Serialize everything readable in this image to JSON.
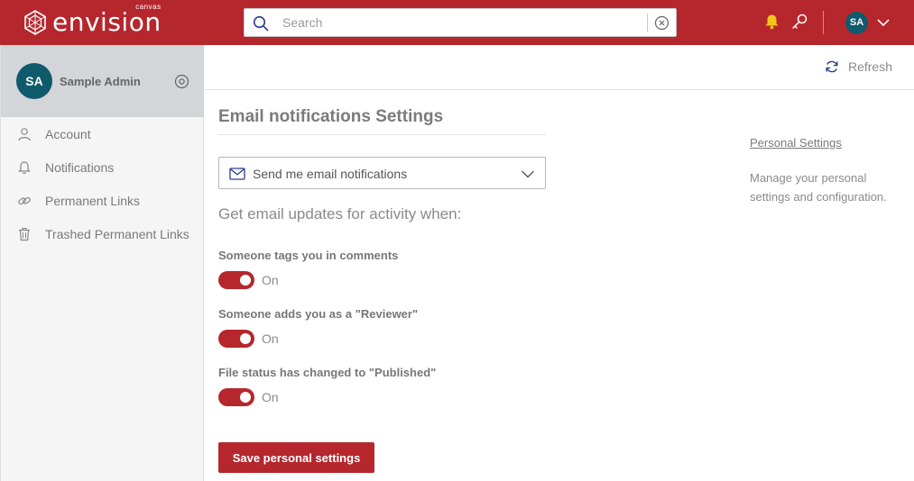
{
  "header": {
    "brand": {
      "name": "envision",
      "sub": "canvas"
    },
    "search": {
      "placeholder": "Search",
      "value": ""
    },
    "user_initials": "SA",
    "icons": [
      "search-icon",
      "clear-icon",
      "bell-icon",
      "key-icon",
      "chevron-down-icon"
    ]
  },
  "sidebar": {
    "profile": {
      "initials": "SA",
      "name": "Sample Admin"
    },
    "items": [
      {
        "label": "Account",
        "icon": "user-icon"
      },
      {
        "label": "Notifications",
        "icon": "bell-icon"
      },
      {
        "label": "Permanent Links",
        "icon": "link-icon"
      },
      {
        "label": "Trashed Permanent Links",
        "icon": "trash-icon"
      }
    ]
  },
  "toolbar": {
    "refresh_label": "Refresh"
  },
  "main": {
    "title": "Email notifications Settings",
    "frequency": {
      "selected": "Send me email notifications"
    },
    "subtitle": "Get email updates for activity when:",
    "options": [
      {
        "label": "Someone tags you in comments",
        "state": "On"
      },
      {
        "label": "Someone adds you as a \"Reviewer\"",
        "state": "On"
      },
      {
        "label": "File status has changed to \"Published\"",
        "state": "On"
      }
    ],
    "save_label": "Save personal settings"
  },
  "right_panel": {
    "link": "Personal Settings",
    "description": "Manage your personal settings and configuration."
  },
  "colors": {
    "brand": "#b5272d",
    "avatar": "#0f5a6b"
  }
}
